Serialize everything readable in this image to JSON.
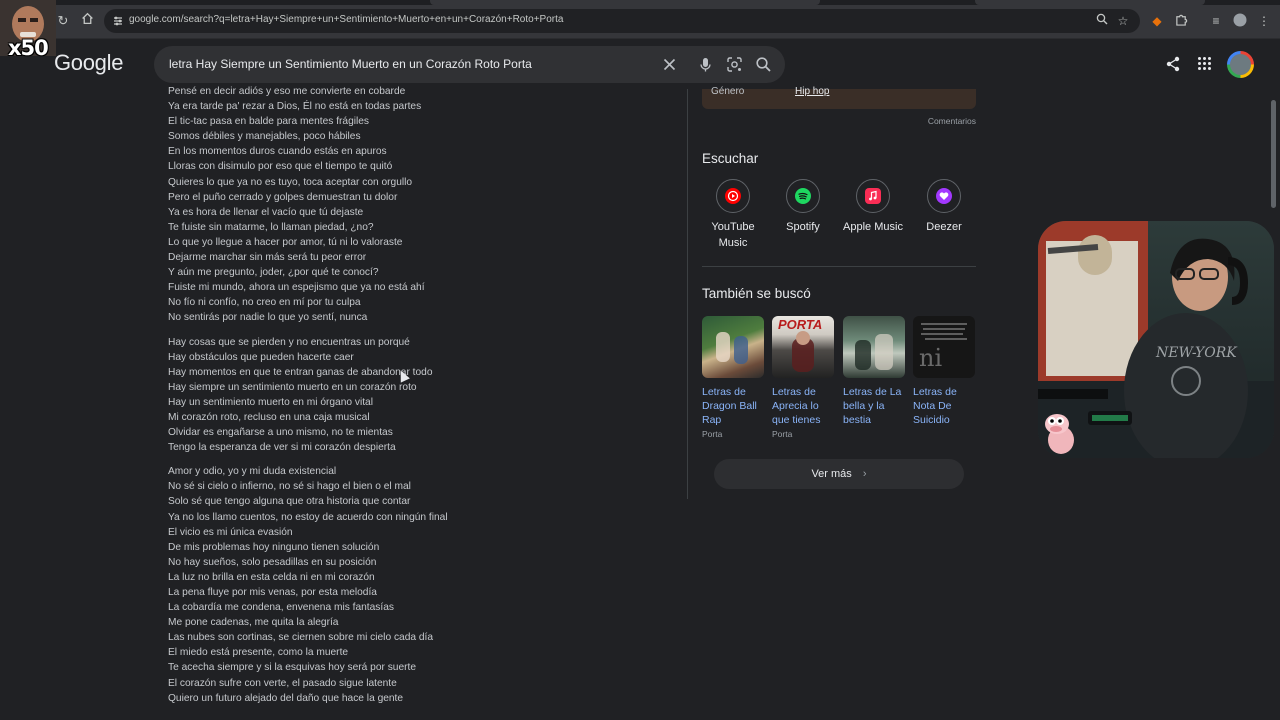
{
  "browser": {
    "url": "google.com/search?q=letra+Hay+Siempre+un+Sentimiento+Muerto+en+un+Coraz%C3%B3n+Roto+Porta",
    "url_display": "google.com/search?q=letra+Hay+Siempre+un+Sentimiento+Muerto+en+un+Corazón+Roto+Porta"
  },
  "header": {
    "logo": "Google",
    "query": "letra Hay Siempre un Sentimiento Muerto en un Corazón Roto Porta"
  },
  "overlay": {
    "multiplier": "x50"
  },
  "lyrics": {
    "stanzas": [
      {
        "lines": [
          "Pensé en decir adiós y eso me convierte en cobarde",
          "Ya era tarde pa' rezar a Dios, Él no está en todas partes",
          "El tic-tac pasa en balde para mentes frágiles",
          "Somos débiles y manejables, poco hábiles",
          "En los momentos duros cuando estás en apuros",
          "Lloras con disimulo por eso que el tiempo te quitó",
          "Quieres lo que ya no es tuyo, toca aceptar con orgullo",
          "Pero el puño cerrado y golpes demuestran tu dolor",
          "Ya es hora de llenar el vacío que tú dejaste",
          "Te fuiste sin matarme, lo llaman piedad, ¿no?",
          "Lo que yo llegue a hacer por amor, tú ni lo valoraste",
          "Dejarme marchar sin más será tu peor error",
          "Y aún me pregunto, joder, ¿por qué te conocí?",
          "Fuiste mi mundo, ahora un espejismo que ya no está ahí",
          "No fío ni confío, no creo en mí por tu culpa",
          "No sentirás por nadie lo que yo sentí, nunca"
        ]
      },
      {
        "lines": [
          "Hay cosas que se pierden y no encuentras un porqué",
          "Hay obstáculos que pueden hacerte caer",
          "Hay momentos en que te entran ganas de abandonar todo",
          "Hay siempre un sentimiento muerto en un corazón roto",
          "Hay un sentimiento muerto en mi órgano vital",
          "Mi corazón roto, recluso en una caja musical",
          "Olvidar es engañarse a uno mismo, no te mientas",
          "Tengo la esperanza de ver si mi corazón despierta"
        ]
      },
      {
        "lines": [
          "Amor y odio, yo y mi duda existencial",
          "No sé si cielo o infierno, no sé si hago el bien o el mal",
          "Solo sé que tengo alguna que otra historia que contar",
          "Ya no los llamo cuentos, no estoy de acuerdo con ningún final",
          "El vicio es mi única evasión",
          "De mis problemas hoy ninguno tienen solución",
          "No hay sueños, solo pesadillas en su posición",
          "La luz no brilla en esta celda ni en mi corazón",
          "La pena fluye por mis venas, por esta melodía",
          "La cobardía me condena, envenena mis fantasías",
          "Me pone cadenas, me quita la alegría",
          "Las nubes son cortinas, se ciernen sobre mi cielo cada día",
          "El miedo está presente, como la muerte",
          "Te acecha siempre y si la esquivas hoy será por suerte",
          "El corazón sufre con verte, el pasado sigue latente",
          "Quiero un futuro alejado del daño que hace la gente"
        ]
      }
    ]
  },
  "knowledge_panel": {
    "genre_key": "Género",
    "genre_value": "Hip hop",
    "comments": "Comentarios",
    "listen_title": "Escuchar",
    "services": [
      {
        "name": "YouTube Music",
        "line1": "YouTube",
        "line2": "Music",
        "color": "#ff0000"
      },
      {
        "name": "Spotify",
        "line1": "Spotify",
        "line2": "",
        "color": "#1ed760"
      },
      {
        "name": "Apple Music",
        "line1": "Apple Music",
        "line2": "",
        "color": "#fa2d55"
      },
      {
        "name": "Deezer",
        "line1": "Deezer",
        "line2": "",
        "color": "#a238ff"
      }
    ],
    "also_searched_title": "También se buscó",
    "cards": [
      {
        "title": "Letras de Dragon Ball Rap",
        "subtitle": "Porta"
      },
      {
        "title": "Letras de Aprecia lo que tienes",
        "subtitle": "Porta",
        "thumb_text": "PORTA"
      },
      {
        "title": "Letras de La bella y la bestia",
        "subtitle": ""
      },
      {
        "title": "Letras de Nota De Suicidio",
        "subtitle": "",
        "thumb_text": "ni no"
      }
    ],
    "more_label": "Ver más"
  }
}
